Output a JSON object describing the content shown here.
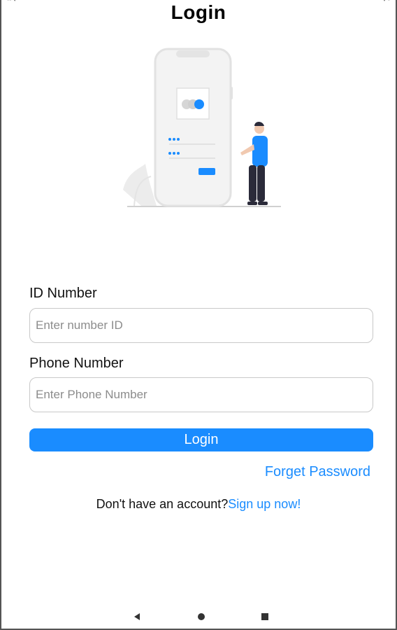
{
  "screen": {
    "title": "Login"
  },
  "form": {
    "id_label": "ID Number",
    "id_placeholder": "Enter number ID",
    "phone_label": "Phone Number",
    "phone_placeholder": "Enter Phone Number",
    "login_label": "Login",
    "forget_label": "Forget Password"
  },
  "signup": {
    "prompt": "Don't have an account?",
    "link_label": "Sign up now!"
  },
  "navbar": {
    "icons": [
      "back-icon",
      "home-icon",
      "recents-icon"
    ]
  },
  "colors": {
    "accent": "#1a8cff",
    "background": "#ffffff",
    "input_border": "#c8c8c8",
    "placeholder": "#8c8c8c"
  }
}
